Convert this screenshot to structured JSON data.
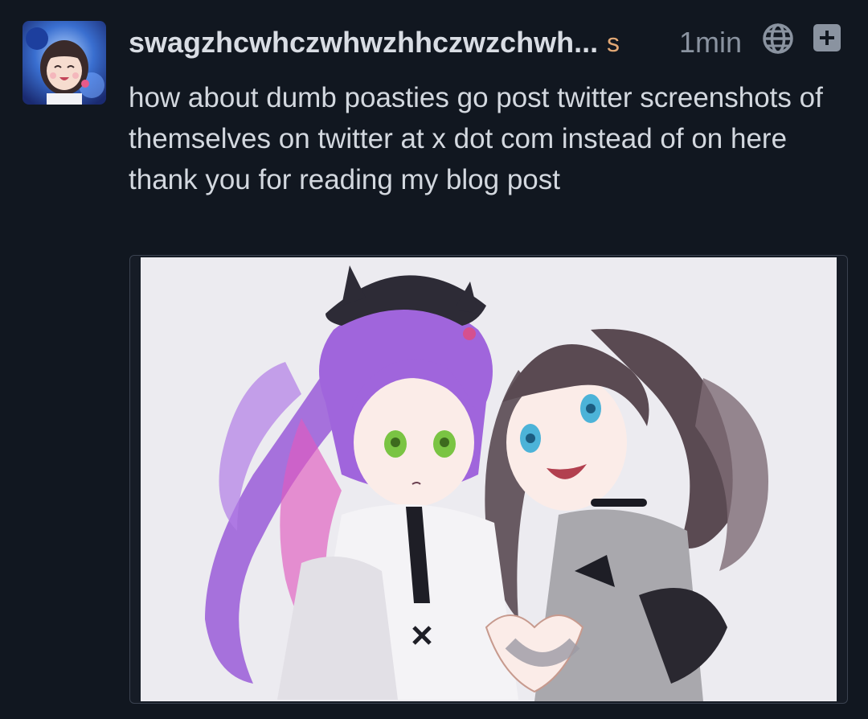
{
  "post": {
    "username": "swagzhcwhczwhwzhhczwzchwh...",
    "badge": "s",
    "time": "1min",
    "visibility_icon": "globe-icon",
    "add_icon": "plus-icon",
    "lines": [
      "how about dumb poasties go post twitter screenshots of themselves on twitter at x dot com instead of on here",
      "thank you for reading my blog post"
    ],
    "colors": {
      "background": "#111720",
      "username": "#d9dde4",
      "badge": "#e2a875",
      "muted": "#8a93a0",
      "text": "#d3d8df"
    }
  }
}
